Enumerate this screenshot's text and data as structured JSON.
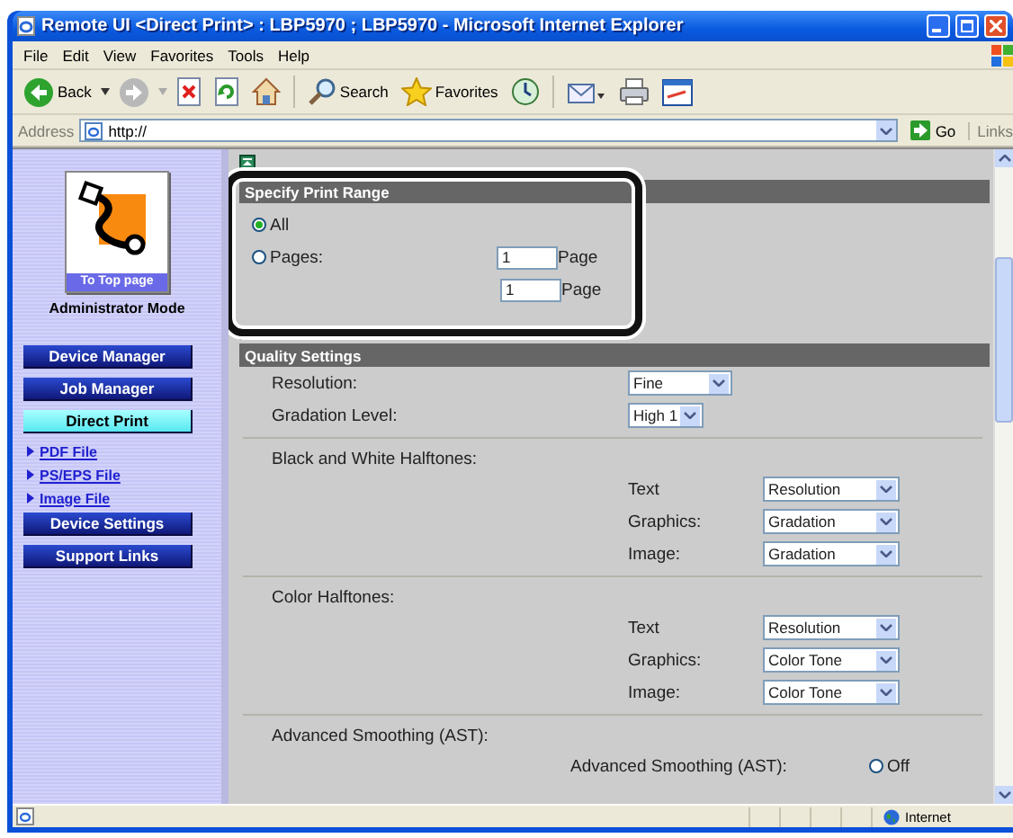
{
  "window": {
    "title": "Remote UI <Direct Print> : LBP5970 ; LBP5970 - Microsoft Internet Explorer"
  },
  "menu": [
    "File",
    "Edit",
    "View",
    "Favorites",
    "Tools",
    "Help"
  ],
  "toolbar": [
    {
      "kind": "back",
      "label": "Back"
    },
    {
      "kind": "forward"
    },
    {
      "kind": "stop"
    },
    {
      "kind": "refresh"
    },
    {
      "kind": "home"
    },
    {
      "kind": "search",
      "label": "Search"
    },
    {
      "kind": "favorites",
      "label": "Favorites"
    },
    {
      "kind": "history"
    },
    {
      "kind": "mail"
    },
    {
      "kind": "print"
    },
    {
      "kind": "edit"
    }
  ],
  "address_bar": {
    "label": "Address",
    "url": "http://",
    "go": "Go",
    "links": "Links"
  },
  "sidebar": {
    "logo_caption": "To Top page",
    "mode": "Administrator Mode",
    "items": [
      {
        "kind": "button",
        "label": "Device Manager",
        "selected": false
      },
      {
        "kind": "button",
        "label": "Job Manager",
        "selected": false
      },
      {
        "kind": "button",
        "label": "Direct Print",
        "selected": true
      },
      {
        "kind": "link",
        "label": "PDF File",
        "selected": false
      },
      {
        "kind": "link",
        "label": "PS/EPS File",
        "selected": false
      },
      {
        "kind": "link",
        "label": "Image File",
        "selected": false
      },
      {
        "kind": "button",
        "label": "Device Settings",
        "selected": false
      },
      {
        "kind": "button",
        "label": "Support Links",
        "selected": false
      }
    ]
  },
  "sections": [
    {
      "title": "Specify Print Range",
      "highlighted": true,
      "rows": [
        {
          "kind": "radio",
          "label": "All",
          "selected": true
        },
        {
          "kind": "radio",
          "label": "Pages:",
          "selected": false,
          "field": {
            "value": "1",
            "unit": "Page"
          }
        },
        {
          "kind": "field",
          "field": {
            "value": "1",
            "unit": "Page"
          }
        }
      ]
    },
    {
      "title": "Quality Settings",
      "highlighted": false,
      "rows": [
        {
          "kind": "select",
          "label": "Resolution:",
          "value": "Fine"
        },
        {
          "kind": "select",
          "label": "Gradation Level:",
          "value": "High 1"
        },
        {
          "kind": "group",
          "label": "Black and White Halftones:",
          "items": [
            {
              "kind": "select",
              "label": "Text",
              "value": "Resolution"
            },
            {
              "kind": "select",
              "label": "Graphics:",
              "value": "Gradation"
            },
            {
              "kind": "select",
              "label": "Image:",
              "value": "Gradation"
            }
          ]
        },
        {
          "kind": "group",
          "label": "Color Halftones:",
          "items": [
            {
              "kind": "select",
              "label": "Text",
              "value": "Resolution"
            },
            {
              "kind": "select",
              "label": "Graphics:",
              "value": "Color Tone"
            },
            {
              "kind": "select",
              "label": "Image:",
              "value": "Color Tone"
            }
          ]
        },
        {
          "kind": "group",
          "label": "Advanced Smoothing (AST):",
          "items": [
            {
              "kind": "radio",
              "label": "Advanced Smoothing (AST):",
              "option": "Off",
              "selected": false
            }
          ]
        }
      ]
    }
  ],
  "status_bar": {
    "zone": "Internet"
  }
}
